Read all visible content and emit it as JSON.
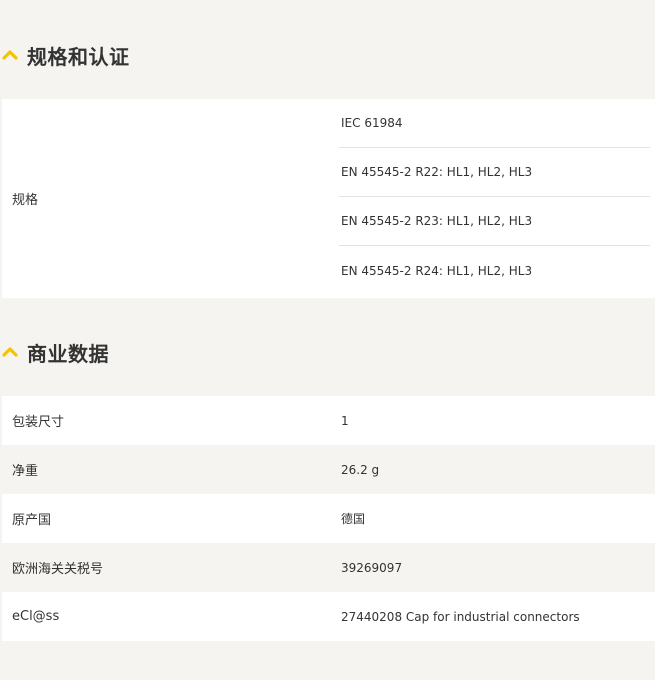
{
  "sections": {
    "cert": {
      "title": "规格和认证",
      "icon": "chevron-up-icon",
      "label": "规格",
      "values": [
        "IEC 61984",
        "EN 45545-2 R22: HL1, HL2, HL3",
        "EN 45545-2 R23: HL1, HL2, HL3",
        "EN 45545-2 R24: HL1, HL2, HL3"
      ]
    },
    "business": {
      "title": "商业数据",
      "icon": "chevron-up-icon",
      "rows": [
        {
          "key": "包装尺寸",
          "value": "1"
        },
        {
          "key": "净重",
          "value": "26.2 g"
        },
        {
          "key": "原产国",
          "value": "德国"
        },
        {
          "key": "欧洲海关关税号",
          "value": "39269097"
        },
        {
          "key": "eCl@ss",
          "value": "27440208 Cap for industrial connectors"
        }
      ]
    }
  },
  "colors": {
    "accent": "#f5c400",
    "background": "#f5f4f0",
    "row_white": "#ffffff",
    "text": "#333333"
  }
}
